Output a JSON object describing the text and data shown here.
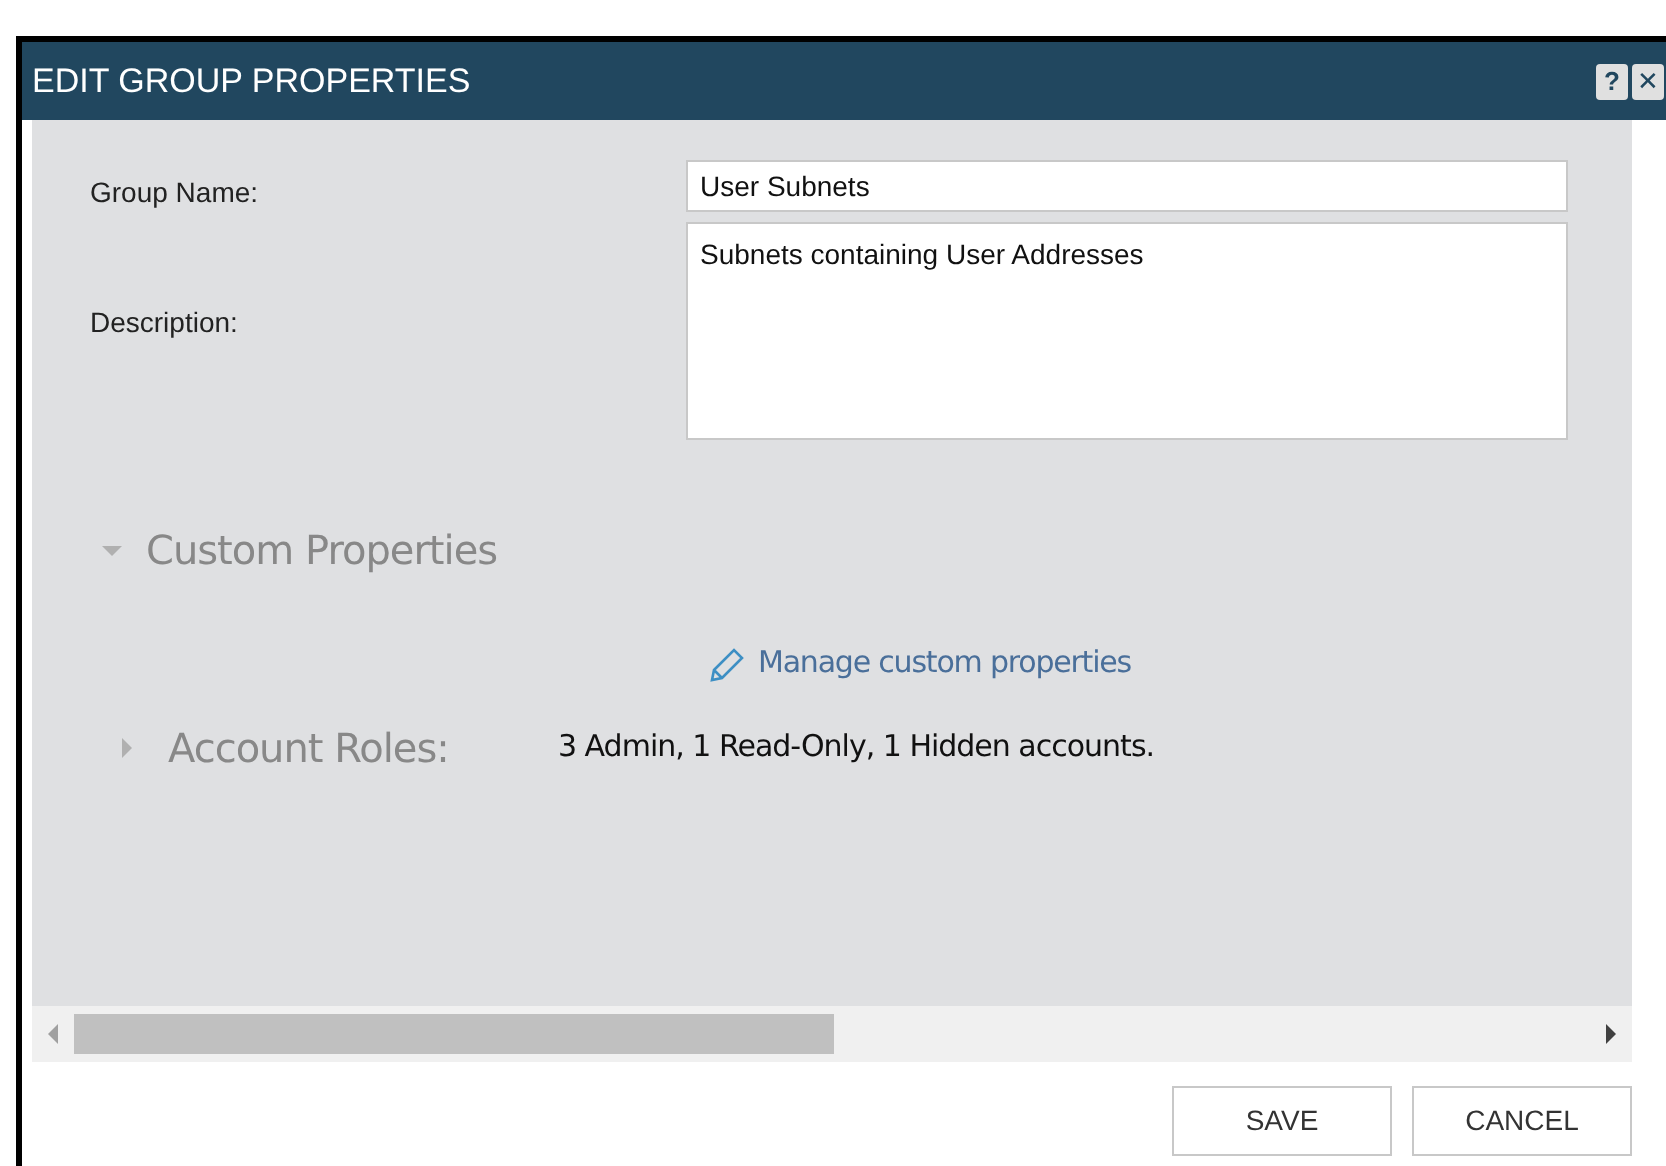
{
  "window": {
    "title": "EDIT GROUP PROPERTIES",
    "help": "?",
    "close": "✕"
  },
  "fields": [
    {
      "label": "Group Name:",
      "value": "User Subnets",
      "kind": "text"
    },
    {
      "label": "Description:",
      "value": "Subnets containing User Addresses",
      "kind": "textarea"
    }
  ],
  "custom_properties": {
    "title": "Custom Properties",
    "expanded": true,
    "link": "Manage custom properties"
  },
  "account_roles": {
    "title": "Account Roles:",
    "expanded": false,
    "summary": "3 Admin, 1 Read-Only, 1 Hidden accounts."
  },
  "buttons": [
    "SAVE",
    "CANCEL"
  ]
}
